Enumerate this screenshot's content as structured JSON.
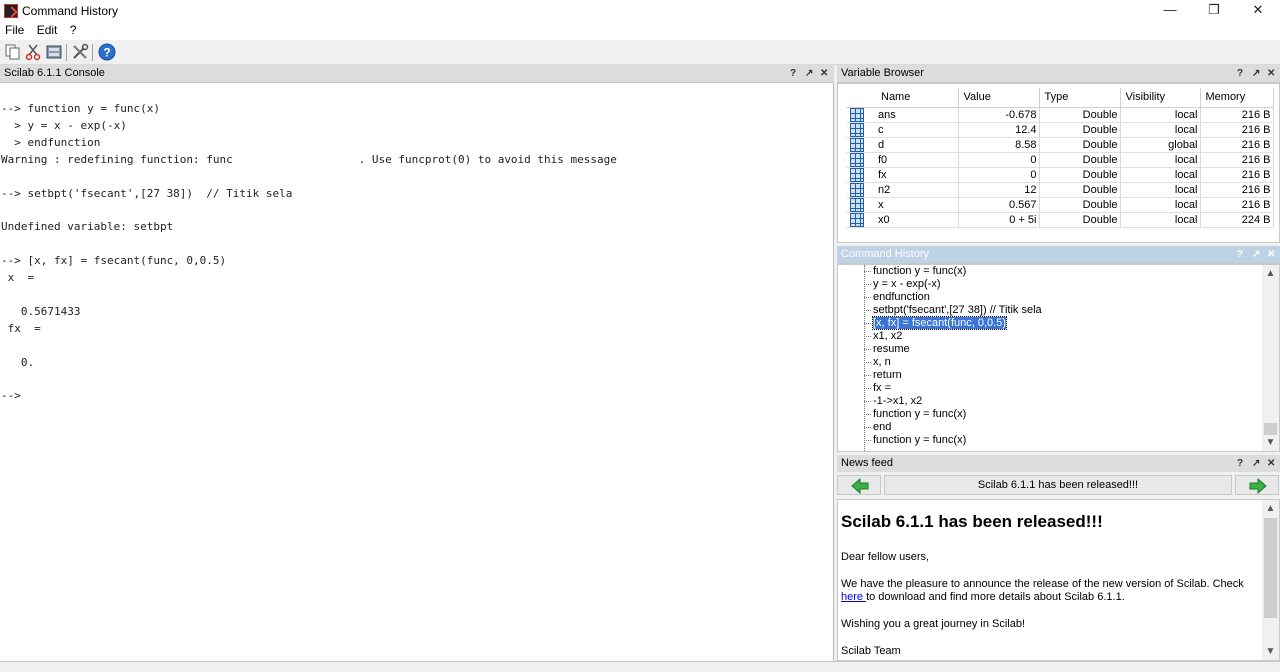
{
  "window": {
    "title": "Command History",
    "controls": {
      "minimize": "—",
      "maximize": "❐",
      "close": "✕"
    }
  },
  "menu": [
    "File",
    "Edit",
    "?"
  ],
  "toolbar": {
    "icons": [
      "copy-icon",
      "cut-icon",
      "clear-history-icon",
      "preferences-icon",
      "help-icon"
    ]
  },
  "panel_controls": {
    "undock": "?",
    "dock": "↗",
    "close": "✕"
  },
  "console": {
    "title": "Scilab 6.1.1 Console",
    "text": "--> function y = func(x)\n  > y = x - exp(-x)\n  > endfunction\nWarning : redefining function: func                   . Use funcprot(0) to avoid this message\n\n--> setbpt('fsecant',[27 38])  // Titik sela\n\nUndefined variable: setbpt\n\n--> [x, fx] = fsecant(func, 0,0.5)\n x  =\n\n   0.5671433\n fx  =\n\n   0.\n\n-->"
  },
  "variable_browser": {
    "title": "Variable Browser",
    "columns": [
      "Name",
      "Value",
      "Type",
      "Visibility",
      "Memory"
    ],
    "rows": [
      [
        "ans",
        "-0.678",
        "Double",
        "local",
        "216 B"
      ],
      [
        "c",
        "12.4",
        "Double",
        "local",
        "216 B"
      ],
      [
        "d",
        "8.58",
        "Double",
        "global",
        "216 B"
      ],
      [
        "f0",
        "0",
        "Double",
        "local",
        "216 B"
      ],
      [
        "fx",
        "0",
        "Double",
        "local",
        "216 B"
      ],
      [
        "n2",
        "12",
        "Double",
        "local",
        "216 B"
      ],
      [
        "x",
        "0.567",
        "Double",
        "local",
        "216 B"
      ],
      [
        "x0",
        "0 + 5i",
        "Double",
        "local",
        "224 B"
      ]
    ]
  },
  "command_history": {
    "title": "Command History",
    "items": [
      "function y = func(x)",
      "y = x - exp(-x)",
      "endfunction",
      "setbpt('fsecant',[27 38])  // Titik sela",
      "[x, fx] = fsecant(func, 0,0.5)",
      "x1, x2",
      "resume",
      "x, n",
      "return",
      "fx =",
      "-1->x1, x2",
      "function y = func(x)",
      "end",
      "function y = func(x)"
    ],
    "selected_index": 4
  },
  "news_feed": {
    "title": "News feed",
    "headline_bar": "Scilab 6.1.1 has been released!!!",
    "article": {
      "heading": "Scilab 6.1.1 has been released!!!",
      "greeting": "Dear fellow users,",
      "body_before_link": "We have the pleasure to announce the release of the new version of Scilab. Check ",
      "link_text": "here ",
      "body_after_link": "to download and find more details about Scilab 6.1.1.",
      "wish": "Wishing you a great journey in Scilab!",
      "signature": "Scilab Team"
    }
  },
  "colors": {
    "active_panel_header": "#bed2e6",
    "selection": "#3875d7",
    "grid_icon": "#1f5fa8",
    "nav_arrow": "#3cb043"
  }
}
